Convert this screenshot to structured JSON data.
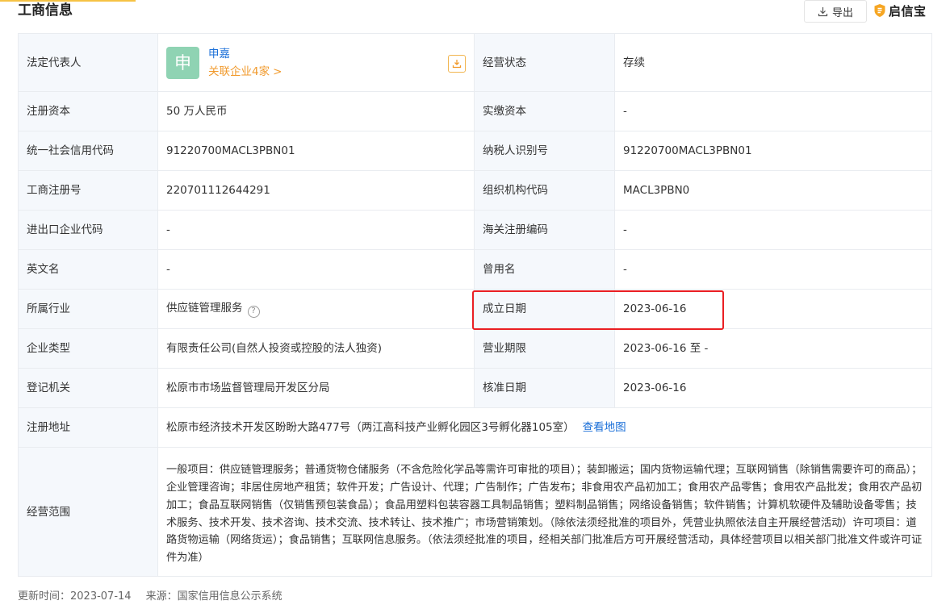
{
  "section": {
    "title": "工商信息"
  },
  "toolbar": {
    "export_label": "导出",
    "brand_name": "启信宝",
    "accent": "#f6c244"
  },
  "legal": {
    "label": "法定代表人",
    "avatar_char": "申",
    "name": "申嘉",
    "related": "关联企业4家",
    "related_arrow": ">",
    "avatar_color": "#8fd3b3"
  },
  "rows": [
    {
      "l1": "法定代表人",
      "v1": "",
      "l2": "经营状态",
      "v2": "存续"
    },
    {
      "l1": "注册资本",
      "v1": "50 万人民币",
      "l2": "实缴资本",
      "v2": "-"
    },
    {
      "l1": "统一社会信用代码",
      "v1": "91220700MACL3PBN01",
      "l2": "纳税人识别号",
      "v2": "91220700MACL3PBN01"
    },
    {
      "l1": "工商注册号",
      "v1": "220701112644291",
      "l2": "组织机构代码",
      "v2": "MACL3PBN0"
    },
    {
      "l1": "进出口企业代码",
      "v1": "-",
      "l2": "海关注册编码",
      "v2": "-"
    },
    {
      "l1": "英文名",
      "v1": "-",
      "l2": "曾用名",
      "v2": "-"
    },
    {
      "l1": "所属行业",
      "v1": "供应链管理服务",
      "l2": "成立日期",
      "v2": "2023-06-16"
    },
    {
      "l1": "企业类型",
      "v1": "有限责任公司(自然人投资或控股的法人独资)",
      "l2": "营业期限",
      "v2": "2023-06-16 至 -"
    },
    {
      "l1": "登记机关",
      "v1": "松原市市场监督管理局开发区分局",
      "l2": "核准日期",
      "v2": "2023-06-16"
    }
  ],
  "address": {
    "label": "注册地址",
    "value": "松原市经济技术开发区盼盼大路477号（两江高科技产业孵化园区3号孵化器105室）",
    "map_link": "查看地图"
  },
  "scope": {
    "label": "经营范围",
    "value": "一般项目：供应链管理服务；普通货物仓储服务（不含危险化学品等需许可审批的项目）；装卸搬运；国内货物运输代理；互联网销售（除销售需要许可的商品）；企业管理咨询；非居住房地产租赁；软件开发；广告设计、代理；广告制作；广告发布；非食用农产品初加工；食用农产品零售；食用农产品批发；食用农产品初加工；食品互联网销售（仅销售预包装食品）；食品用塑料包装容器工具制品销售；塑料制品销售；网络设备销售；软件销售；计算机软硬件及辅助设备零售；技术服务、技术开发、技术咨询、技术交流、技术转让、技术推广；市场营销策划。（除依法须经批准的项目外，凭营业执照依法自主开展经营活动）许可项目：道路货物运输（网络货运）；食品销售；互联网信息服务。（依法须经批准的项目，经相关部门批准后方可开展经营活动，具体经营项目以相关部门批准文件或许可证件为准）"
  },
  "footer": {
    "updated": "更新时间：2023-07-14",
    "source": "来源：国家信用信息公示系统"
  },
  "highlight": {
    "color": "#ea1f23",
    "target": "成立日期"
  },
  "industry_help_icon": "question-circle-icon"
}
